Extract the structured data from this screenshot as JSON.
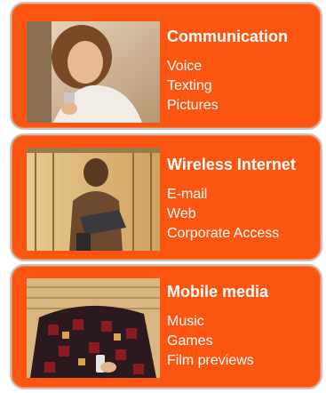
{
  "panels": [
    {
      "title": "Communication",
      "items": [
        "Voice",
        "Texting",
        "Pictures"
      ],
      "photo": "woman-with-phone-photo"
    },
    {
      "title": "Wireless Internet",
      "items": [
        "E-mail",
        "Web",
        "Corporate Access"
      ],
      "photo": "man-with-laptop-photo"
    },
    {
      "title": "Mobile media",
      "items": [
        "Music",
        "Games",
        "Film previews"
      ],
      "photo": "person-under-blanket-with-phone-photo"
    }
  ],
  "colors": {
    "panel_bg": "#fb5512",
    "text": "#ffffff",
    "border": "#c9c4c0"
  }
}
